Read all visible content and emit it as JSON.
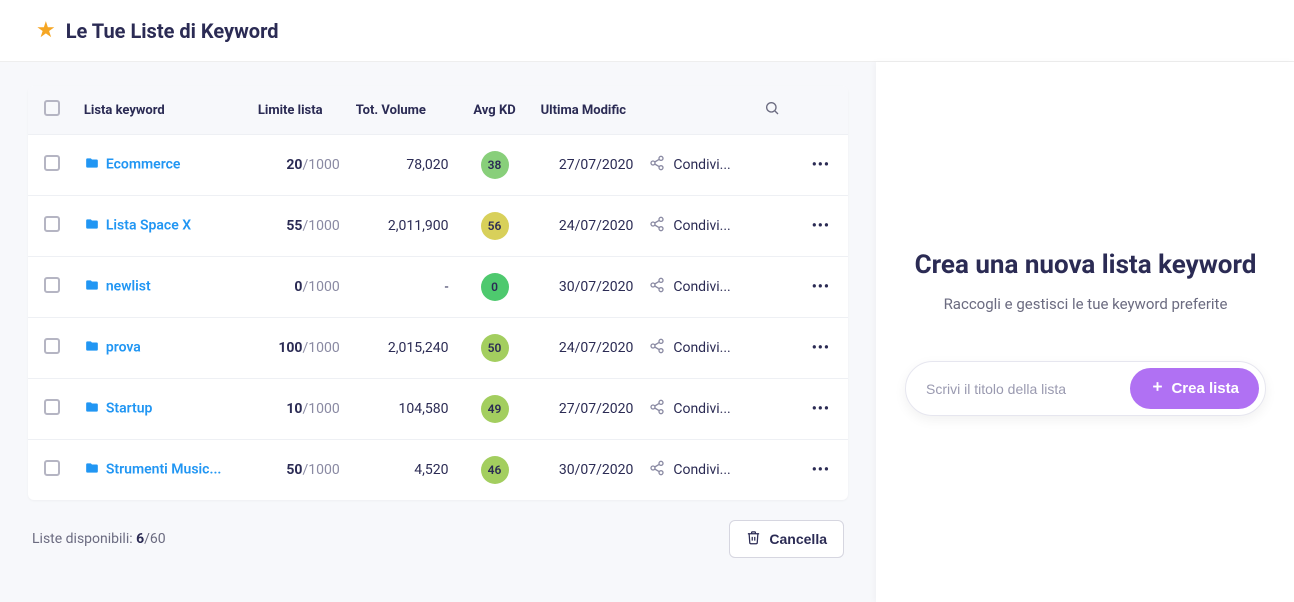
{
  "header": {
    "title": "Le Tue Liste di Keyword"
  },
  "table": {
    "columns": {
      "name": "Lista keyword",
      "limit": "Limite lista",
      "volume": "Tot. Volume",
      "kd": "Avg KD",
      "modified": "Ultima Modific"
    },
    "share_label": "Condivi...",
    "rows": [
      {
        "name": "Ecommerce",
        "used": "20",
        "total": "/1000",
        "volume": "78,020",
        "kd": "38",
        "kd_color": "#88cf7a",
        "date": "27/07/2020"
      },
      {
        "name": "Lista Space X",
        "used": "55",
        "total": "/1000",
        "volume": "2,011,900",
        "kd": "56",
        "kd_color": "#d8d05a",
        "date": "24/07/2020"
      },
      {
        "name": "newlist",
        "used": "0",
        "total": "/1000",
        "volume": "-",
        "kd": "0",
        "kd_color": "#4ec96e",
        "date": "30/07/2020"
      },
      {
        "name": "prova",
        "used": "100",
        "total": "/1000",
        "volume": "2,015,240",
        "kd": "50",
        "kd_color": "#a3ce5f",
        "date": "24/07/2020"
      },
      {
        "name": "Startup",
        "used": "10",
        "total": "/1000",
        "volume": "104,580",
        "kd": "49",
        "kd_color": "#a3ce5f",
        "date": "27/07/2020"
      },
      {
        "name": "Strumenti Music...",
        "used": "50",
        "total": "/1000",
        "volume": "4,520",
        "kd": "46",
        "kd_color": "#a3ce5f",
        "date": "30/07/2020"
      }
    ]
  },
  "footer": {
    "available_label": "Liste disponibili: ",
    "available_count": "6",
    "available_total": "/60",
    "cancel_label": "Cancella"
  },
  "side": {
    "title": "Crea una nuova lista keyword",
    "subtitle": "Raccogli e gestisci le tue keyword preferite",
    "placeholder": "Scrivi il titolo della lista",
    "create_label": "Crea lista"
  }
}
